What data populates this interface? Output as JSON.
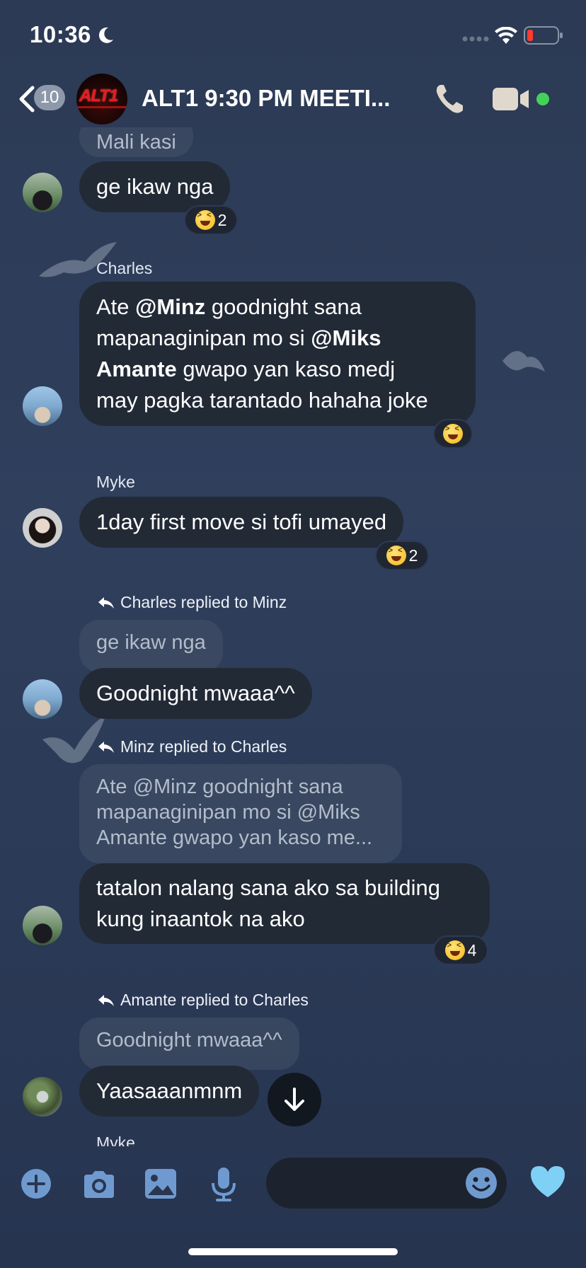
{
  "status_bar": {
    "time": "10:36"
  },
  "header": {
    "back_count": "10",
    "group_logo": "ALT1",
    "title": "ALT1 9:30 PM MEETI...",
    "online_color": "#44d15a"
  },
  "messages": {
    "m0": {
      "quote": "Mali kasi",
      "text": "ge ikaw nga",
      "reaction_count": "2"
    },
    "m1": {
      "sender": "Charles",
      "line1_a": "Ate ",
      "line1_mention": "@Minz",
      "line1_b": " goodnight sana",
      "line2_a": "mapanaginipan mo si ",
      "line2_mention": "@Miks",
      "line3_mention": "Amante",
      "line3_b": " gwapo yan kaso medj",
      "line4": "may pagka tarantado hahaha joke"
    },
    "m2": {
      "sender": "Myke",
      "text": "1day first move si tofi umayed",
      "reaction_count": "2"
    },
    "m3": {
      "reply_note": "Charles replied to Minz",
      "quote": "ge ikaw nga",
      "text": "Goodnight mwaaa^^"
    },
    "m4": {
      "reply_note": "Minz replied to Charles",
      "quote_line1": "Ate @Minz goodnight sana",
      "quote_line2": "mapanaginipan mo si @Miks",
      "quote_line3": "Amante gwapo yan kaso me...",
      "text_line1": "tatalon nalang sana ako sa building",
      "text_line2": "kung inaantok na ako",
      "reaction_count": "4"
    },
    "m5": {
      "reply_note": "Amante replied to Charles",
      "quote": "Goodnight mwaaa^^",
      "text": "Yaasaaanmnm"
    },
    "next_sender": "Myke"
  },
  "icons": {
    "back": "chevron-left-icon",
    "call": "phone-icon",
    "video": "video-camera-icon",
    "plus": "plus-circle-icon",
    "camera": "camera-icon",
    "gallery": "image-icon",
    "mic": "microphone-icon",
    "emoji": "smiley-icon",
    "like": "blue-heart-icon",
    "scroll": "arrow-down-icon",
    "reaction": "laughing-emoji-icon"
  },
  "colors": {
    "bubble": "#222a36",
    "background": "#2e3d5a",
    "heart": "#7fd0f5",
    "icon": "#6f9ad0"
  }
}
